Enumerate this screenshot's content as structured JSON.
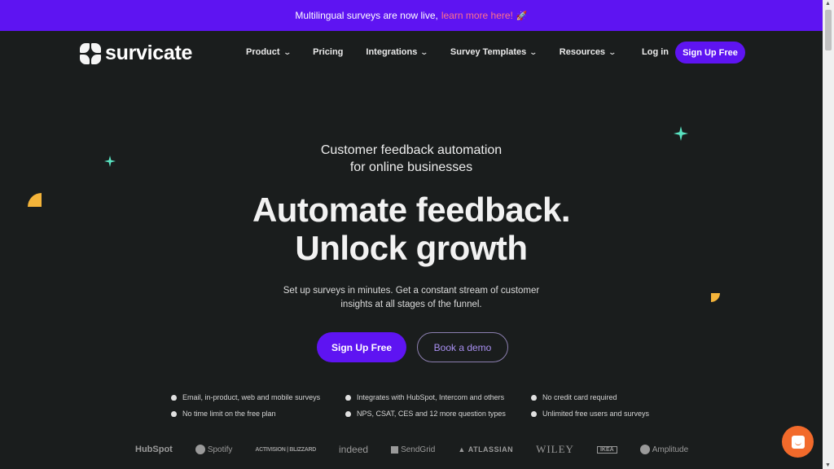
{
  "banner": {
    "text": "Multilingual surveys are now live,",
    "link": "learn more here!",
    "emoji": "🚀"
  },
  "nav": {
    "logo": "survicate",
    "items": [
      {
        "label": "Product",
        "dropdown": true
      },
      {
        "label": "Pricing",
        "dropdown": false
      },
      {
        "label": "Integrations",
        "dropdown": true
      },
      {
        "label": "Survey Templates",
        "dropdown": true
      },
      {
        "label": "Resources",
        "dropdown": true
      }
    ],
    "chevron": "⌄",
    "login": "Log in",
    "signup": "Sign Up Free"
  },
  "hero": {
    "eyebrow_line1": "Customer feedback automation",
    "eyebrow_line2": "for online businesses",
    "headline_line1": "Automate feedback.",
    "headline_line2": "Unlock growth",
    "sub_line1": "Set up surveys in minutes. Get a constant stream of customer",
    "sub_line2": "insights at all stages of the funnel.",
    "primary_cta": "Sign Up Free",
    "secondary_cta": "Book a demo"
  },
  "features": [
    "Email, in-product, web and mobile surveys",
    "Integrates with HubSpot, Intercom and others",
    "No credit card required",
    "No time limit on the free plan",
    "NPS, CSAT, CES and 12 more question types",
    "Unlimited free users and surveys"
  ],
  "logos": [
    "HubSpot",
    "Spotify",
    "ACTIVISION | BLIZZARD",
    "indeed",
    "SendGrid",
    "ATLASSIAN",
    "WILEY",
    "IKEA",
    "Amplitude"
  ],
  "colors": {
    "brand": "#5e14f2",
    "background": "#1a1d1d",
    "link": "#ff6f8c",
    "accent_teal": "#59e3c1",
    "accent_yellow": "#f4b43a",
    "chat": "#f26a2b"
  }
}
